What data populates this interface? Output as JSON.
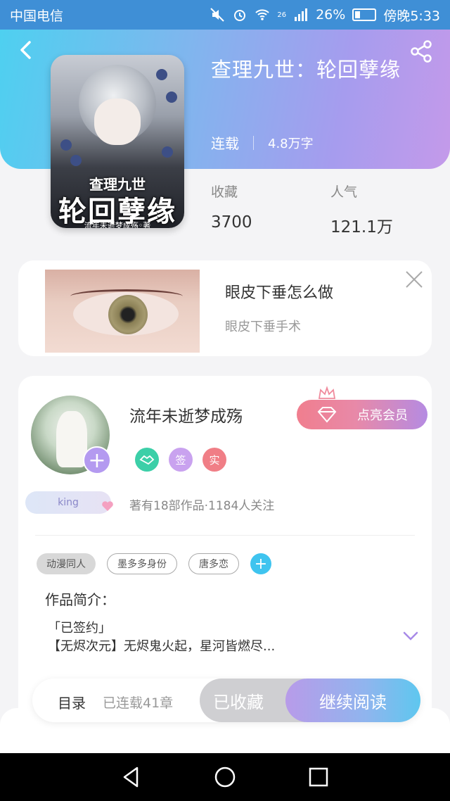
{
  "status_bar": {
    "carrier": "中国电信",
    "network": "26",
    "battery": "26%",
    "battery_level": 0.26,
    "time": "傍晚5:33"
  },
  "book": {
    "title": "查理九世：轮回孽缘",
    "status": "连载",
    "word_count": "4.8万字",
    "cover": {
      "line1": "查理九世",
      "line2": "轮回孽缘",
      "author_line": "流年未逝梦成殇◦著"
    },
    "stats": [
      {
        "label": "收藏",
        "value": "3700"
      },
      {
        "label": "人气",
        "value": "121.1万"
      }
    ]
  },
  "ad": {
    "title": "眼皮下垂怎么做",
    "subtitle": "眼皮下垂手术"
  },
  "author": {
    "name": "流年未逝梦成殇",
    "badges": [
      {
        "icon": "handshake-icon",
        "text": "",
        "color": "#3ccfa8"
      },
      {
        "icon": "sign-badge",
        "text": "签",
        "color": "#c9a2ef"
      },
      {
        "icon": "verified-badge",
        "text": "实",
        "color": "#f07e86"
      }
    ],
    "vip_label": "点亮会员",
    "level_tag": "king",
    "info": "著有18部作品·1184人关注"
  },
  "tags": [
    "动漫同人",
    "墨多多身份",
    "唐多恋"
  ],
  "intro": {
    "label": "作品简介：",
    "line1": "「已签约」",
    "line2": "【无烬次元】无烬鬼火起，星河皆燃尽..."
  },
  "action_bar": {
    "toc_label": "目录",
    "toc_sub": "已连载41章",
    "collected_label": "已收藏",
    "read_label": "继续阅读"
  },
  "colors": {
    "accent_purple": "#b49af0",
    "accent_blue": "#3fc4ef",
    "vip_pink": "#f07e8e"
  }
}
